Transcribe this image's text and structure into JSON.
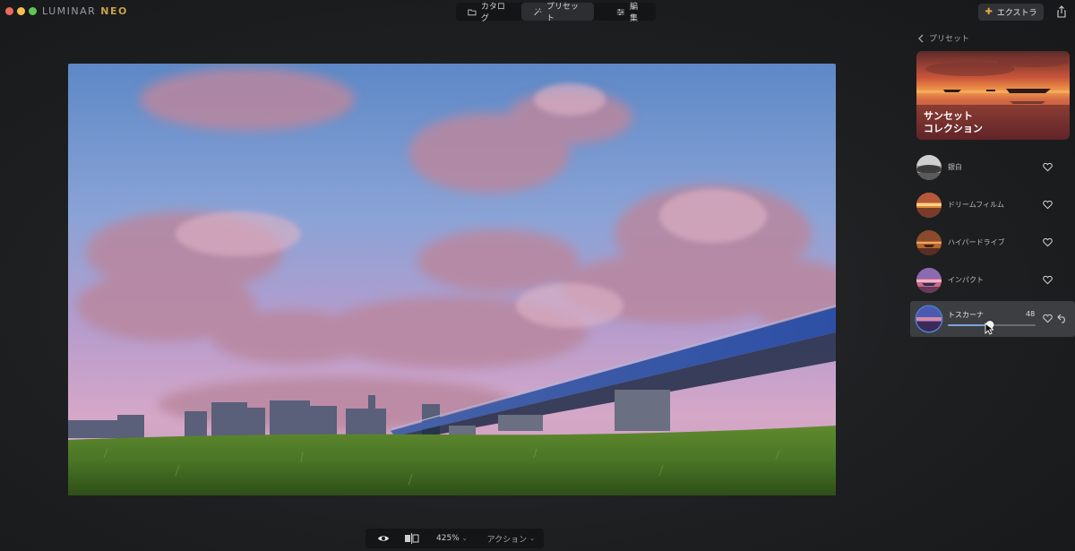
{
  "app": {
    "brand_main": "LUMINAR ",
    "brand_accent": "NEO"
  },
  "nav": {
    "catalog": "カタログ",
    "presets": "プリセット",
    "edit": "編集",
    "active": "presets"
  },
  "extra": {
    "label": "エクストラ"
  },
  "bottombar": {
    "zoom": "425%",
    "action": "アクション"
  },
  "panel": {
    "back_label": "プリセット",
    "collection_title": "サンセット\nコレクション",
    "presets": [
      {
        "name": "銀白",
        "thumb": "silver"
      },
      {
        "name": "ドリームフィルム",
        "thumb": "dream"
      },
      {
        "name": "ハイパードライブ",
        "thumb": "hyper"
      },
      {
        "name": "インパクト",
        "thumb": "impact"
      },
      {
        "name": "トスカーナ",
        "thumb": "tuscany",
        "selected": true,
        "amount": "48",
        "amount_fraction": 0.48
      }
    ]
  },
  "colors": {
    "accent_blue": "#4e7fd1",
    "extra_icon": "#e8a447",
    "brand_neo": "#c9a24a"
  }
}
